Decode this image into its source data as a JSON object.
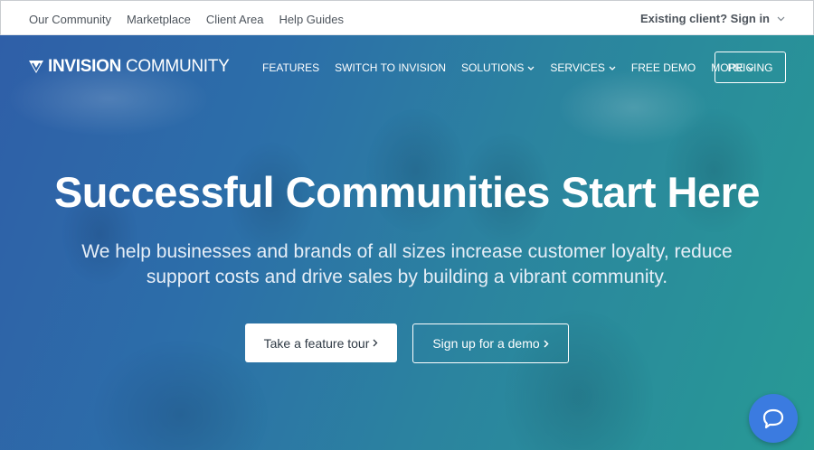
{
  "topbar": {
    "links": [
      "Our Community",
      "Marketplace",
      "Client Area",
      "Help Guides"
    ],
    "signin_label": "Existing client? Sign in"
  },
  "nav": {
    "brand_bold": "INVISION",
    "brand_light": " COMMUNITY",
    "items": [
      {
        "label": "FEATURES",
        "dropdown": false
      },
      {
        "label": "SWITCH TO INVISION",
        "dropdown": false
      },
      {
        "label": "SOLUTIONS",
        "dropdown": true
      },
      {
        "label": "SERVICES",
        "dropdown": true
      },
      {
        "label": "FREE DEMO",
        "dropdown": false
      },
      {
        "label": "MORE",
        "dropdown": true
      }
    ],
    "pricing_label": "PRICING"
  },
  "hero": {
    "headline": "Successful Communities Start Here",
    "subhead": "We help businesses and brands of all sizes increase customer loyalty, reduce support costs and drive sales by building a vibrant community.",
    "tour_label": "Take a feature tour",
    "demo_label": "Sign up for a demo"
  },
  "colors": {
    "hero_start": "#2f5fa8",
    "hero_end": "#279a95",
    "chat_button": "#3b7be0"
  },
  "icons": {
    "logo": "invision-logo-icon",
    "chat": "chat-bubble-icon",
    "chevron": "chevron-down-icon",
    "arrow": "chevron-right-icon"
  }
}
